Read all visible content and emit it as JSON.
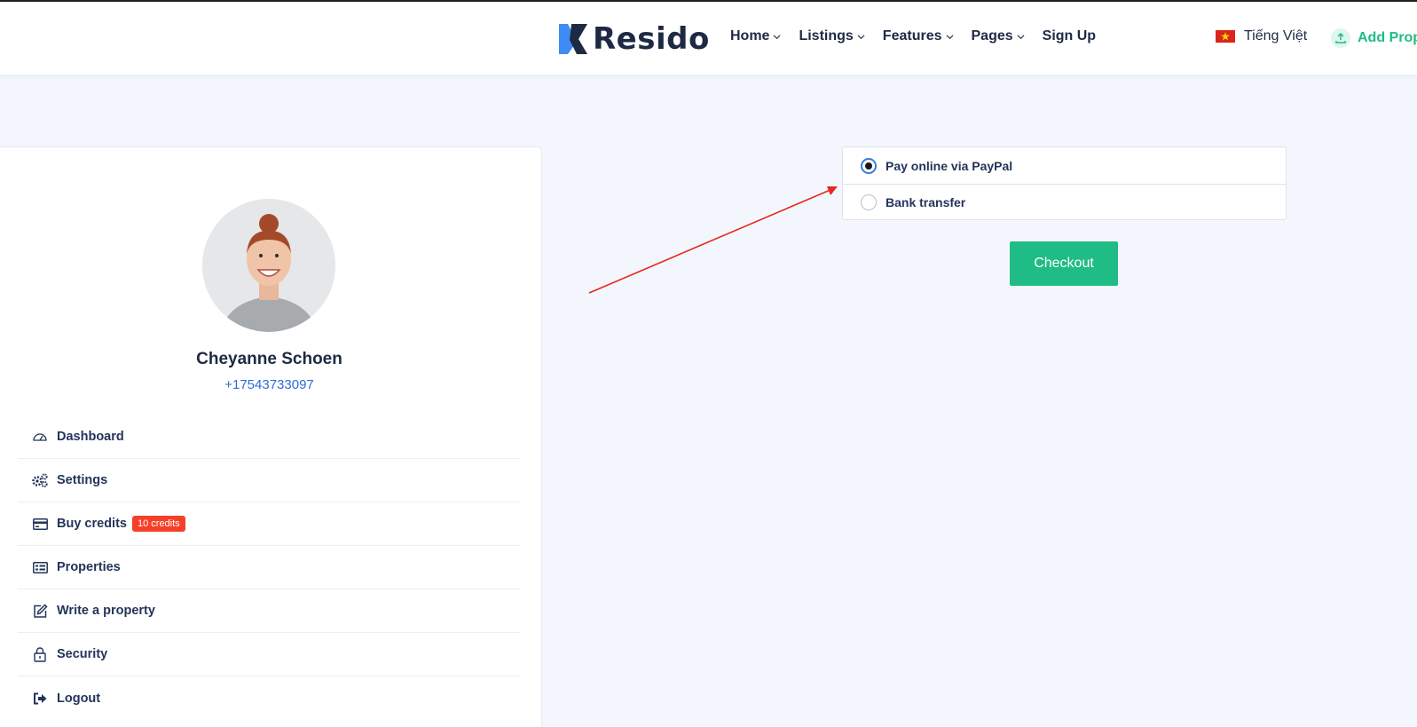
{
  "header": {
    "logo_text": "Resido",
    "nav": [
      {
        "label": "Home",
        "has_dropdown": true
      },
      {
        "label": "Listings",
        "has_dropdown": true
      },
      {
        "label": "Features",
        "has_dropdown": true
      },
      {
        "label": "Pages",
        "has_dropdown": true
      },
      {
        "label": "Sign Up",
        "has_dropdown": false
      }
    ],
    "language": "Tiếng Việt",
    "add_property": "Add Prope"
  },
  "profile": {
    "name": "Cheyanne Schoen",
    "phone": "+17543733097"
  },
  "menu": [
    {
      "label": "Dashboard",
      "icon": "dashboard-icon"
    },
    {
      "label": "Settings",
      "icon": "gears-icon"
    },
    {
      "label": "Buy credits",
      "icon": "credit-card-icon",
      "badge": "10 credits"
    },
    {
      "label": "Properties",
      "icon": "list-icon"
    },
    {
      "label": "Write a property",
      "icon": "edit-icon"
    },
    {
      "label": "Security",
      "icon": "lock-icon"
    },
    {
      "label": "Logout",
      "icon": "sign-out-icon"
    }
  ],
  "payment": {
    "options": [
      {
        "label": "Pay online via PayPal",
        "selected": true
      },
      {
        "label": "Bank transfer",
        "selected": false
      }
    ],
    "checkout_label": "Checkout"
  },
  "colors": {
    "accent": "#1fbc85",
    "badge": "#f54029",
    "link": "#2d6bd8",
    "annotation_arrow": "#e8281c"
  }
}
